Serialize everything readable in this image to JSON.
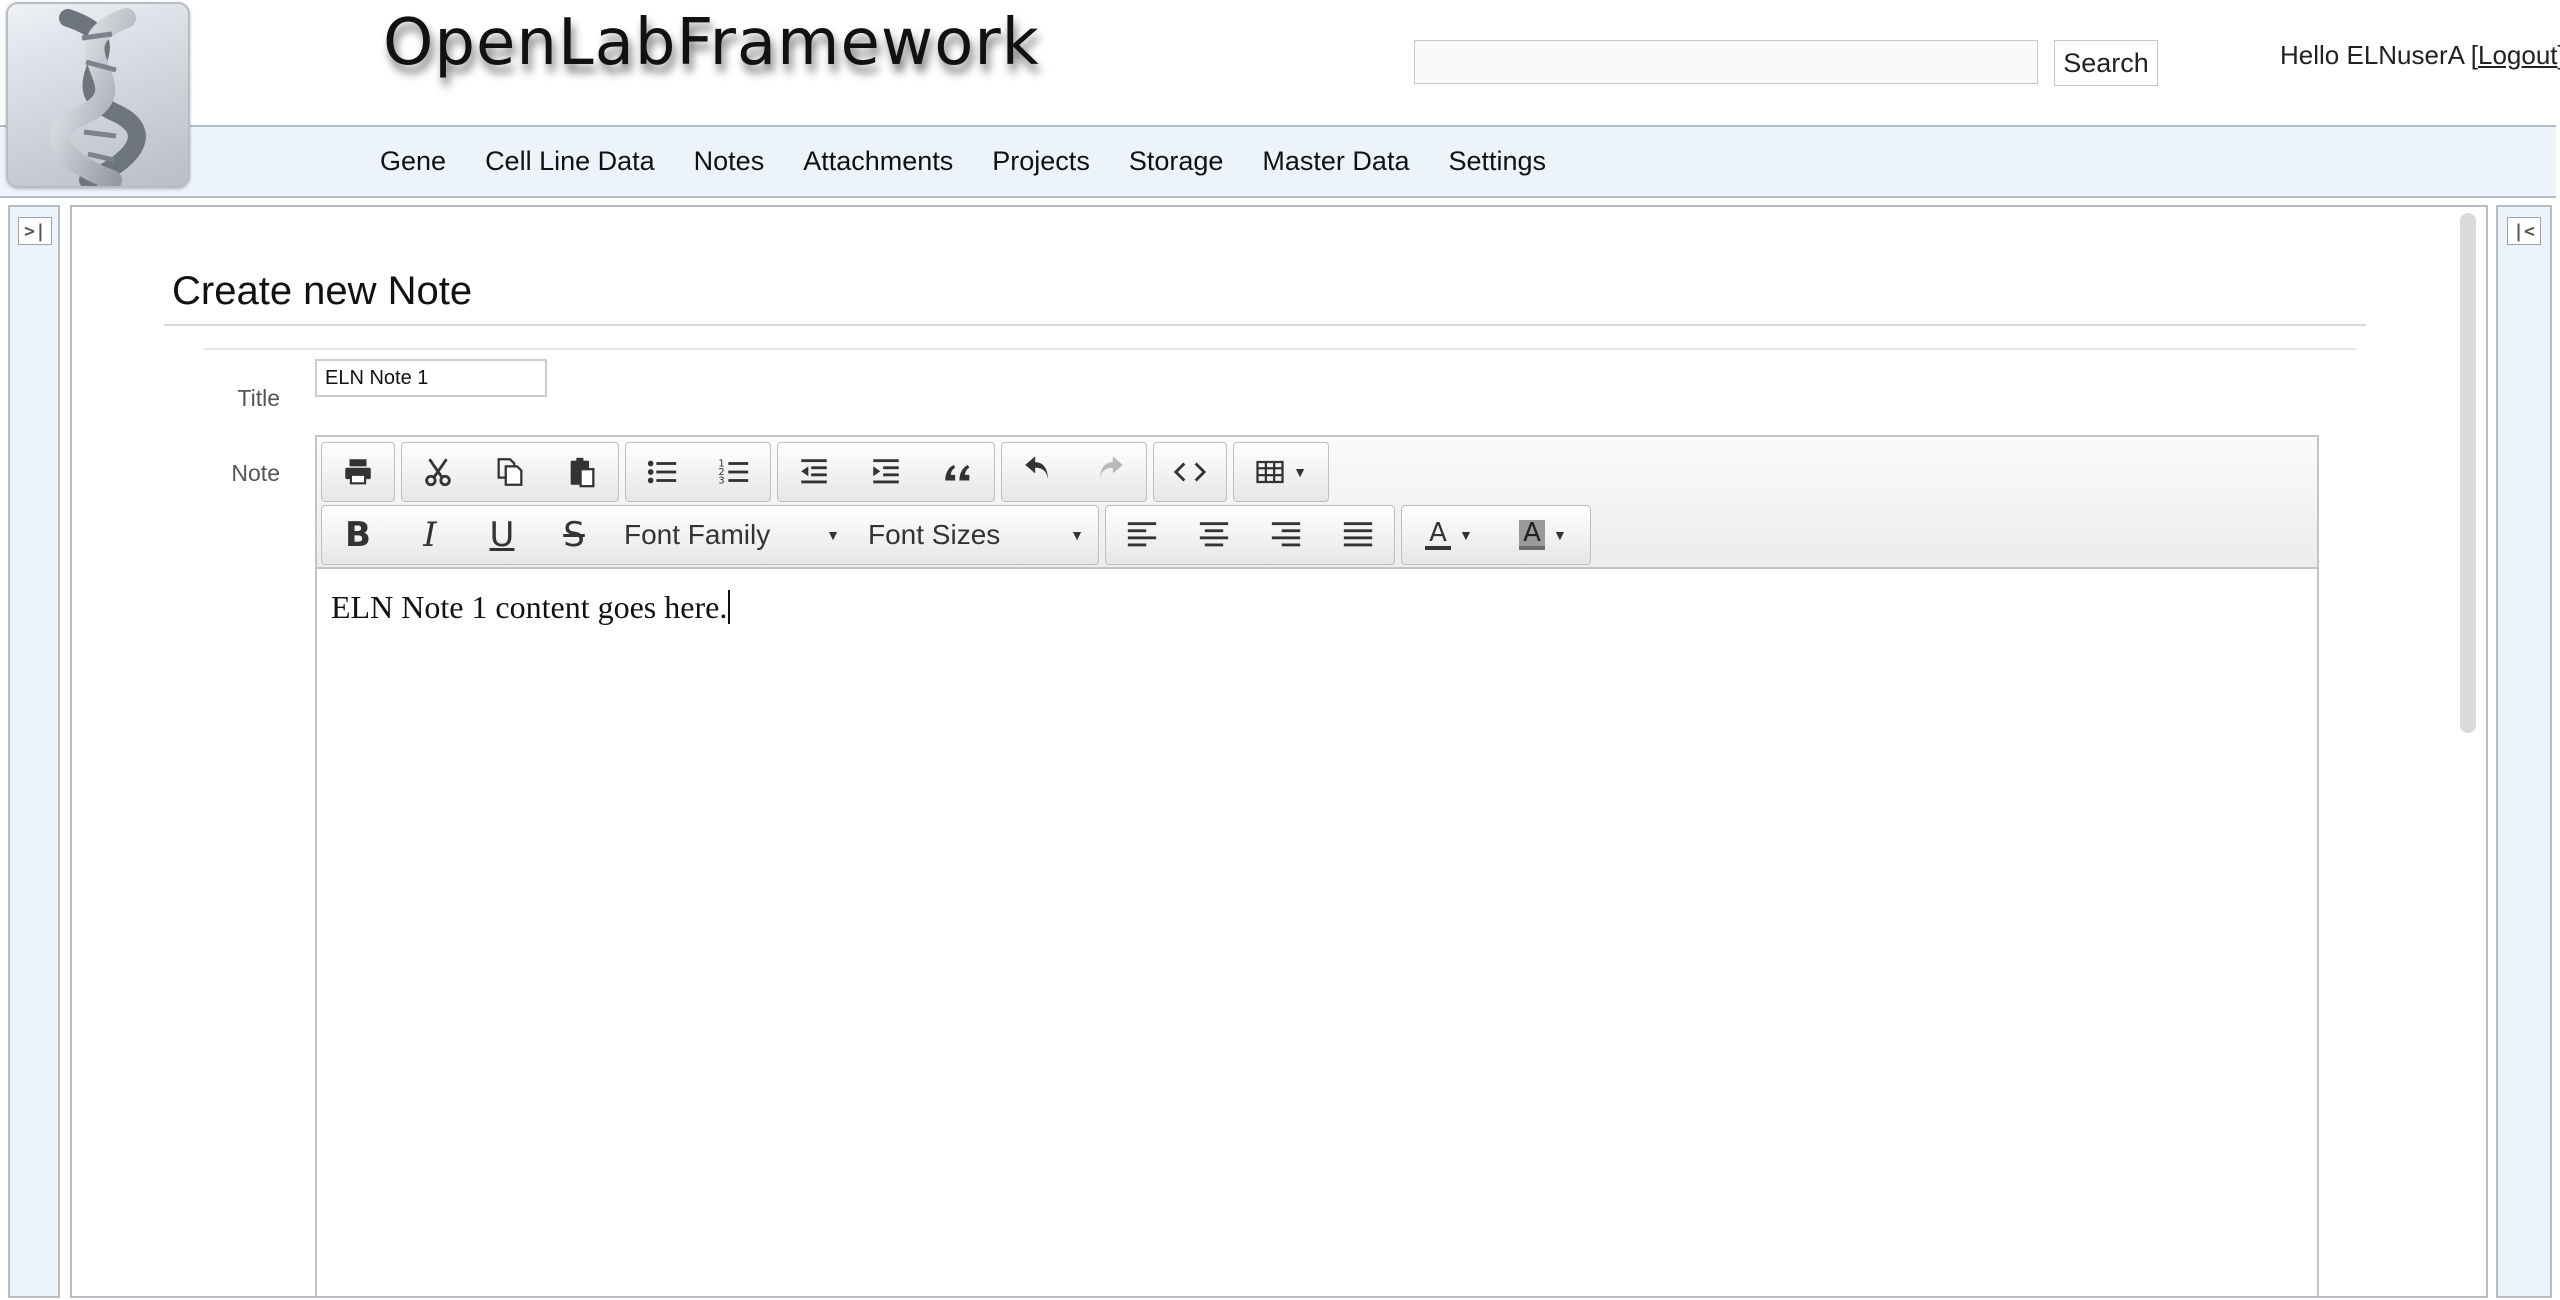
{
  "header": {
    "app_title": "OpenLabFramework",
    "search_value": "",
    "search_button": "Search",
    "greeting_prefix": "Hello ELNuserA ",
    "logout_label": "Logout"
  },
  "nav": {
    "items": [
      "Gene",
      "Cell Line Data",
      "Notes",
      "Attachments",
      "Projects",
      "Storage",
      "Master Data",
      "Settings"
    ]
  },
  "page": {
    "title": "Create new Note",
    "title_label": "Title",
    "title_value": "ELN Note 1",
    "note_label": "Note"
  },
  "editor": {
    "font_family_label": "Font Family",
    "font_sizes_label": "Font Sizes",
    "content": "ELN Note 1 content goes here.",
    "icons": [
      "print-icon",
      "cut-icon",
      "copy-icon",
      "paste-icon",
      "bullet-list-icon",
      "numbered-list-icon",
      "outdent-icon",
      "indent-icon",
      "blockquote-icon",
      "undo-icon",
      "redo-icon",
      "source-code-icon",
      "table-icon",
      "bold-icon",
      "italic-icon",
      "underline-icon",
      "strikethrough-icon",
      "align-left-icon",
      "align-center-icon",
      "align-right-icon",
      "align-justify-icon",
      "text-color-icon",
      "background-color-icon"
    ]
  },
  "colors": {
    "nav_background": "#edf3fb",
    "border": "#b5bcc6",
    "toolbar_background": "#ececec"
  }
}
